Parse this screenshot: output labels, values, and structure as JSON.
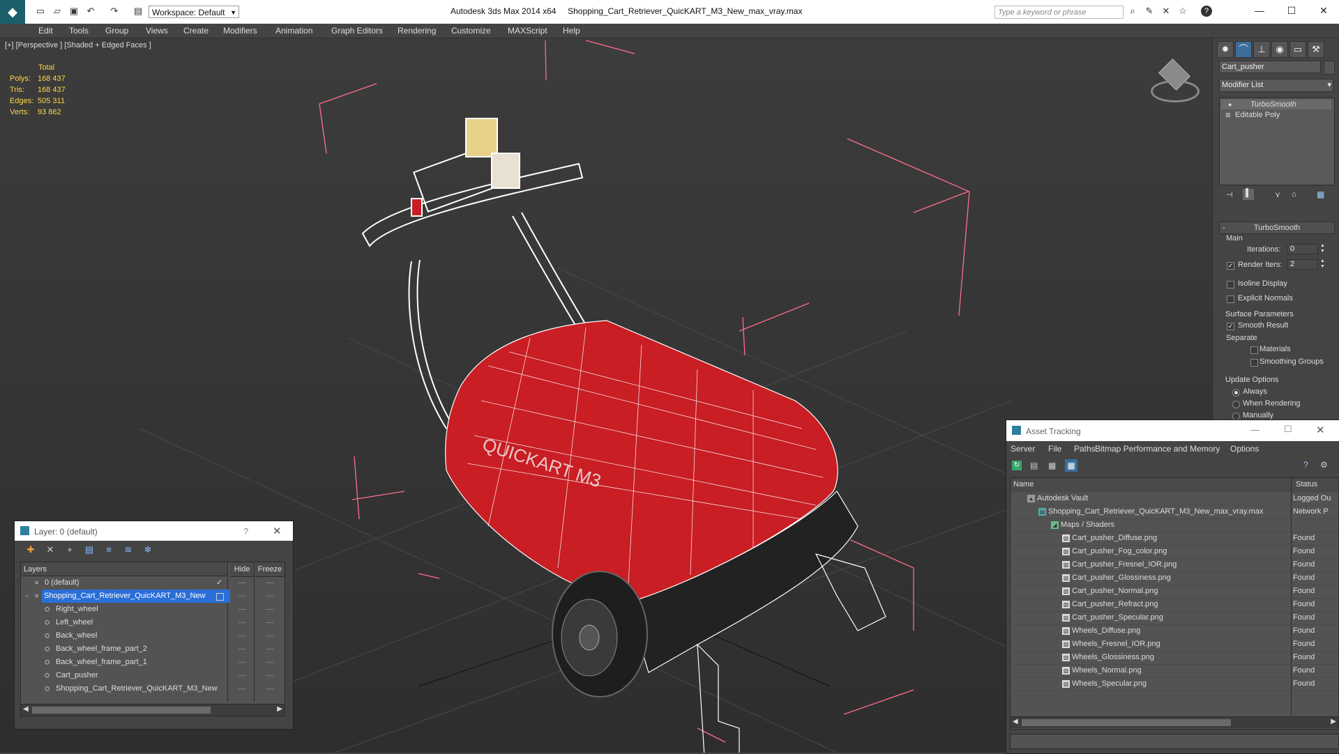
{
  "titlebar": {
    "app": "Autodesk 3ds Max  2014 x64",
    "file": "Shopping_Cart_Retriever_QuicKART_M3_New_max_vray.max",
    "workspace": "Workspace: Default",
    "search_placeholder": "Type a keyword or phrase"
  },
  "menu": [
    "Edit",
    "Tools",
    "Group",
    "Views",
    "Create",
    "Modifiers",
    "Animation",
    "Graph Editors",
    "Rendering",
    "Customize",
    "MAXScript",
    "Help"
  ],
  "viewport": {
    "label": "[+] [Perspective ] [Shaded + Edged Faces ]",
    "stats": {
      "header": "Total",
      "rows": [
        {
          "label": "Polys:",
          "value": "168 437"
        },
        {
          "label": "Tris:",
          "value": "168 437"
        },
        {
          "label": "Edges:",
          "value": "505 311"
        },
        {
          "label": "Verts:",
          "value": "93 862"
        }
      ]
    },
    "model_colors": {
      "body": "#c81e24",
      "wire": "#ffffff",
      "bbox": "#ff6f8a"
    }
  },
  "command_panel": {
    "object_name": "Cart_pusher",
    "modifier_list": "Modifier List",
    "stack": [
      "TurboSmooth",
      "Editable Poly"
    ],
    "turbosmooth": {
      "title": "TurboSmooth",
      "main": "Main",
      "iterations_label": "Iterations:",
      "iterations": "0",
      "render_iters_label": "Render Iters:",
      "render_iters": "2",
      "isoline": "Isoline Display",
      "explicit_normals": "Explicit Normals",
      "surface_params": "Surface Parameters",
      "smooth_result": "Smooth Result",
      "separate": "Separate",
      "materials": "Materials",
      "smoothing_groups": "Smoothing Groups",
      "update_options": "Update Options",
      "always": "Always",
      "when_rendering": "When Rendering",
      "manually": "Manually"
    }
  },
  "layer_window": {
    "title": "Layer: 0 (default)",
    "help": "?",
    "col_layers": "Layers",
    "col_hide": "Hide",
    "col_freeze": "Freeze",
    "rows": [
      {
        "name": "0 (default)",
        "indent": 0
      },
      {
        "name": "Shopping_Cart_Retriever_QuicKART_M3_New",
        "indent": 0
      },
      {
        "name": "Right_wheel",
        "indent": 1
      },
      {
        "name": "Left_wheel",
        "indent": 1
      },
      {
        "name": "Back_wheel",
        "indent": 1
      },
      {
        "name": "Back_wheel_frame_part_2",
        "indent": 1
      },
      {
        "name": "Back_wheel_frame_part_1",
        "indent": 1
      },
      {
        "name": "Cart_pusher",
        "indent": 1
      },
      {
        "name": "Shopping_Cart_Retriever_QuicKART_M3_New",
        "indent": 1
      }
    ]
  },
  "asset_window": {
    "title": "Asset Tracking",
    "menu": [
      "Server",
      "File",
      "Paths",
      "Bitmap Performance and Memory",
      "Options"
    ],
    "col_name": "Name",
    "col_status": "Status",
    "rows": [
      {
        "name": "Autodesk Vault",
        "status": "Logged Ou",
        "indent": 1
      },
      {
        "name": "Shopping_Cart_Retriever_QuicKART_M3_New_max_vray.max",
        "status": "Network P",
        "indent": 2
      },
      {
        "name": "Maps / Shaders",
        "status": "",
        "indent": 3
      },
      {
        "name": "Cart_pusher_Diffuse.png",
        "status": "Found",
        "indent": 4
      },
      {
        "name": "Cart_pusher_Fog_color.png",
        "status": "Found",
        "indent": 4
      },
      {
        "name": "Cart_pusher_Fresnel_IOR.png",
        "status": "Found",
        "indent": 4
      },
      {
        "name": "Cart_pusher_Glossiness.png",
        "status": "Found",
        "indent": 4
      },
      {
        "name": "Cart_pusher_Normal.png",
        "status": "Found",
        "indent": 4
      },
      {
        "name": "Cart_pusher_Refract.png",
        "status": "Found",
        "indent": 4
      },
      {
        "name": "Cart_pusher_Specular.png",
        "status": "Found",
        "indent": 4
      },
      {
        "name": "Wheels_Diffuse.png",
        "status": "Found",
        "indent": 4
      },
      {
        "name": "Wheels_Fresnel_IOR.png",
        "status": "Found",
        "indent": 4
      },
      {
        "name": "Wheels_Glossiness.png",
        "status": "Found",
        "indent": 4
      },
      {
        "name": "Wheels_Normal.png",
        "status": "Found",
        "indent": 4
      },
      {
        "name": "Wheels_Specular.png",
        "status": "Found",
        "indent": 4
      }
    ]
  }
}
